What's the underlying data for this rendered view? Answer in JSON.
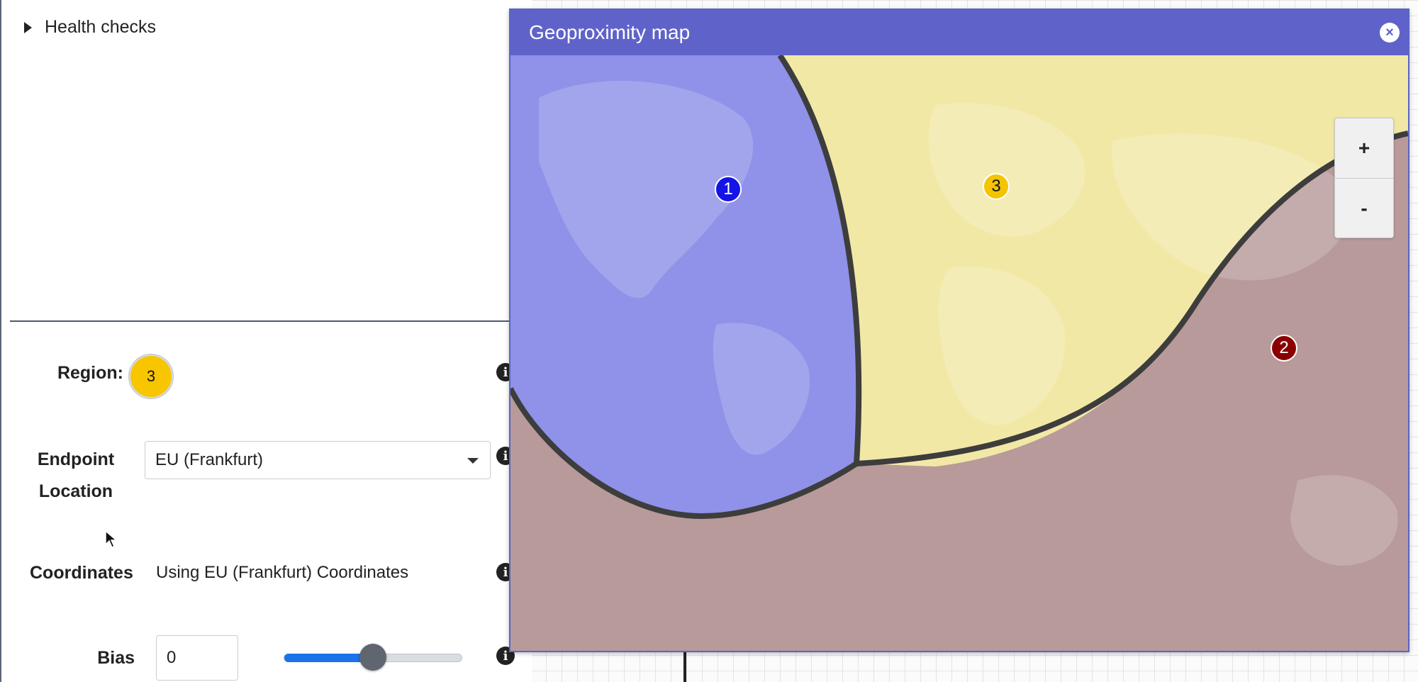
{
  "health_checks": {
    "label": "Health checks"
  },
  "region": {
    "label": "Region:",
    "value": "3"
  },
  "endpoint": {
    "label_line1": "Endpoint",
    "label_line2": "Location",
    "selected": "EU (Frankfurt)"
  },
  "coordinates": {
    "label": "Coordinates",
    "text": "Using EU (Frankfurt) Coordinates"
  },
  "bias": {
    "label": "Bias",
    "value": "0",
    "slider_fraction": 0.5
  },
  "map": {
    "title": "Geoproximity map",
    "zoom_in": "+",
    "zoom_out": "-",
    "markers": [
      {
        "label": "1",
        "color": "#1414e6"
      },
      {
        "label": "2",
        "color": "#8a0000"
      },
      {
        "label": "3",
        "color": "#f4c400"
      }
    ],
    "region_colors": {
      "r1": "#8f92e8",
      "r2": "#b89a9a",
      "r3": "#f2e8a6"
    }
  },
  "icons": {
    "info": "info-icon",
    "close": "close-icon",
    "caret": "chevron-down-icon",
    "disclosure": "triangle-right-icon",
    "cursor": "mouse-pointer-icon"
  }
}
